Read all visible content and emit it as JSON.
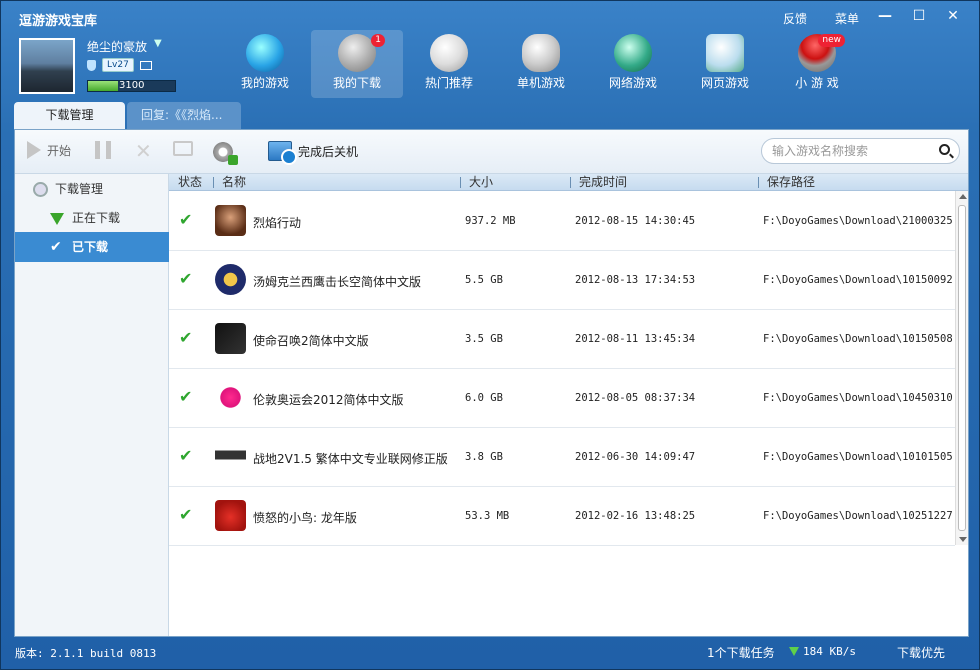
{
  "app": {
    "title": "逗游游戏宝库"
  },
  "top_links": {
    "feedback": "反馈",
    "menu": "菜单"
  },
  "window_controls": {
    "minimize": "—",
    "maximize": "☐",
    "close": "✕"
  },
  "user": {
    "name": "绝尘的豪放",
    "level": "Lv27",
    "exp": "3100",
    "exp_progress": 0.34
  },
  "nav": [
    {
      "label": "我的游戏",
      "icon": "my-games-icon"
    },
    {
      "label": "我的下载",
      "icon": "my-downloads-icon",
      "badge": "1"
    },
    {
      "label": "热门推荐",
      "icon": "hot-recommend-icon"
    },
    {
      "label": "单机游戏",
      "icon": "gamepad-icon"
    },
    {
      "label": "网络游戏",
      "icon": "online-game-icon"
    },
    {
      "label": "网页游戏",
      "icon": "web-game-icon"
    },
    {
      "label": "小 游 戏",
      "icon": "joystick-icon",
      "badge": "new"
    }
  ],
  "tabs": {
    "active": "下载管理",
    "inactive": "回复:《《烈焰..."
  },
  "toolbar": {
    "start": "开始",
    "shutdown_after": "完成后关机"
  },
  "search": {
    "placeholder": "输入游戏名称搜索",
    "value": ""
  },
  "sidebar": {
    "title": "下载管理",
    "downloading": "正在下载",
    "downloaded": "已下载"
  },
  "table": {
    "headers": {
      "status": "状态",
      "name": "名称",
      "size": "大小",
      "time": "完成时间",
      "path": "保存路径"
    },
    "rows": [
      {
        "name": "烈焰行动",
        "size": "937.2 MB",
        "time": "2012-08-15 14:30:45",
        "path": "F:\\DoyoGames\\Download\\21000325"
      },
      {
        "name": "汤姆克兰西鹰击长空简体中文版",
        "size": "5.5 GB",
        "time": "2012-08-13 17:34:53",
        "path": "F:\\DoyoGames\\Download\\10150092"
      },
      {
        "name": "使命召唤2简体中文版",
        "size": "3.5 GB",
        "time": "2012-08-11 13:45:34",
        "path": "F:\\DoyoGames\\Download\\10150508"
      },
      {
        "name": "伦敦奥运会2012简体中文版",
        "size": "6.0 GB",
        "time": "2012-08-05 08:37:34",
        "path": "F:\\DoyoGames\\Download\\10450310"
      },
      {
        "name": "战地2V1.5 繁体中文专业联网修正版",
        "size": "3.8 GB",
        "time": "2012-06-30 14:09:47",
        "path": "F:\\DoyoGames\\Download\\10101505"
      },
      {
        "name": "愤怒的小鸟: 龙年版",
        "size": "53.3 MB",
        "time": "2012-02-16 13:48:25",
        "path": "F:\\DoyoGames\\Download\\10251227"
      }
    ]
  },
  "status_bar": {
    "version": "版本: 2.1.1 build 0813",
    "tasks": "1个下载任务",
    "speed": "184 KB/s",
    "priority": "下载优先"
  }
}
